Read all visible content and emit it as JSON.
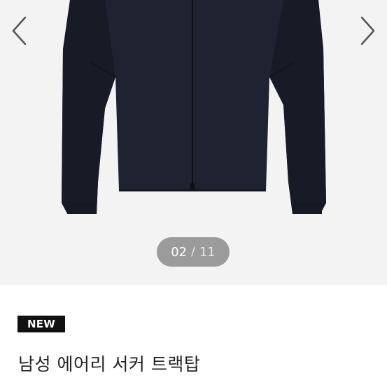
{
  "gallery": {
    "current": "02",
    "separator": "/",
    "total": "11",
    "prev_icon": "chevron-left-icon",
    "next_icon": "chevron-right-icon",
    "image": "black zip-up track jacket"
  },
  "product": {
    "badge": "NEW",
    "title": "남성 에어리 서커 트랙탑"
  },
  "colors": {
    "gallery_bg": "#f3f3f3",
    "counter_bg": "#9b9b9b",
    "badge_bg": "#111111",
    "jacket": "#1f2230"
  }
}
